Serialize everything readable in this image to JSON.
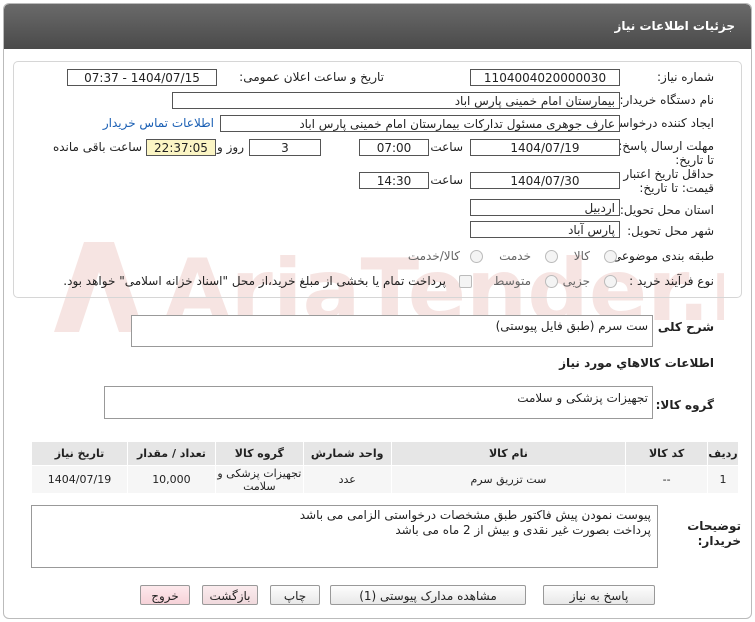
{
  "title": "جزئیات اطلاعات نیاز",
  "fields": {
    "need_number_label": "شماره نیاز:",
    "need_number": "1104004020000030",
    "announce_label": "تاریخ و ساعت اعلان عمومی:",
    "announce_value": "1404/07/15 - 07:37",
    "buyer_label": "نام دستگاه خریدار:",
    "buyer_value": "بیمارستان امام خمینی پارس اباد",
    "creator_label": "ایجاد کننده درخواست:",
    "creator_value": "عارف جوهری مسئول تدارکات بیمارستان امام خمینی پارس اباد",
    "contact_link": "اطلاعات تماس خریدار",
    "deadline_label": "مهلت ارسال پاسخ: تا تاریخ:",
    "deadline_date": "1404/07/19",
    "time_label": "ساعت",
    "deadline_time": "07:00",
    "days": "3",
    "days_label": "روز و",
    "remaining_time": "22:37:05",
    "remaining_label": "ساعت باقی مانده",
    "validity_label": "حداقل تاریخ اعتبار قیمت: تا تاریخ:",
    "validity_date": "1404/07/30",
    "validity_time": "14:30",
    "province_label": "استان محل تحویل:",
    "province_value": "اردبیل",
    "city_label": "شهر محل تحویل:",
    "city_value": "پارس آباد",
    "category_label": "طبقه بندی موضوعی:",
    "category_options": [
      "کالا",
      "خدمت",
      "کالا/خدمت"
    ],
    "process_label": "نوع فرآیند خرید :",
    "process_options": [
      "جزیی",
      "متوسط"
    ],
    "payment_note": "پرداخت تمام یا بخشی از مبلغ خرید،از محل \"اسناد خزانه اسلامی\" خواهد بود."
  },
  "summary": {
    "label": "شرح کلی نیاز:",
    "value": "ست سرم (طبق فایل پیوستی)"
  },
  "goods_info_title": "اطلاعات کالاهاي مورد نياز",
  "goods_group": {
    "label": "گروه کالا:",
    "value": "تجهیزات پزشکی و سلامت"
  },
  "table": {
    "headers": [
      "ردیف",
      "کد کالا",
      "نام کالا",
      "واحد شمارش",
      "گروه کالا",
      "تعداد / مقدار",
      "تاریخ نیاز"
    ],
    "rows": [
      [
        "1",
        "--",
        "ست تزریق سرم",
        "عدد",
        "تجهیزات پزشکی و سلامت",
        "10,000",
        "1404/07/19"
      ]
    ]
  },
  "buyer_notes": {
    "label": "توضیحات خریدار:",
    "line1": "پیوست نمودن پیش فاکتور طبق مشخصات درخواستی الزامی می باشد",
    "line2": "پرداخت بصورت غیر نقدی و بیش از 2 ماه می باشد"
  },
  "buttons": {
    "reply": "پاسخ به نیاز",
    "view_docs": "مشاهده مدارک پیوستی (1)",
    "print": "چاپ",
    "back": "بازگشت",
    "exit": "خروج"
  },
  "watermark_text": "AriaTender.neT",
  "colors": {
    "link": "#1a5fb4",
    "remaining_bg": "#fbf5c4",
    "titlebar": "#555555"
  }
}
